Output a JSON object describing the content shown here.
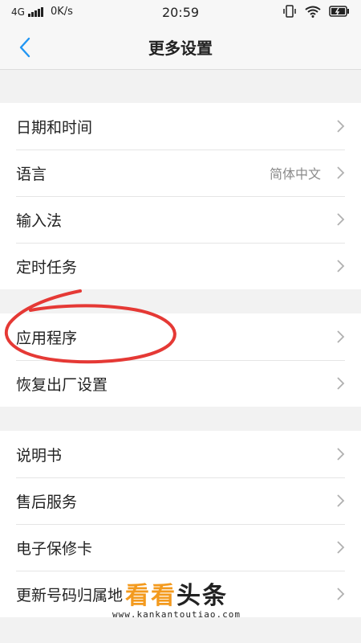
{
  "status_bar": {
    "network": "4G",
    "speed": "0K/s",
    "time": "20:59"
  },
  "header": {
    "title": "更多设置"
  },
  "settings": {
    "group1": [
      {
        "label": "日期和时间",
        "value": ""
      },
      {
        "label": "语言",
        "value": "简体中文"
      },
      {
        "label": "输入法",
        "value": ""
      },
      {
        "label": "定时任务",
        "value": ""
      }
    ],
    "group2": [
      {
        "label": "应用程序",
        "value": ""
      },
      {
        "label": "恢复出厂设置",
        "value": ""
      }
    ],
    "group3": [
      {
        "label": "说明书",
        "value": ""
      },
      {
        "label": "售后服务",
        "value": ""
      },
      {
        "label": "电子保修卡",
        "value": ""
      },
      {
        "label": "更新号码归属地",
        "value": ""
      }
    ]
  },
  "watermark": {
    "title_orange": "看看",
    "title_black": "头条",
    "url": "www.kankantoutiao.com"
  },
  "colors": {
    "accent": "#2196f3",
    "annotation": "#e53935",
    "watermark_orange": "#f39a1e"
  }
}
